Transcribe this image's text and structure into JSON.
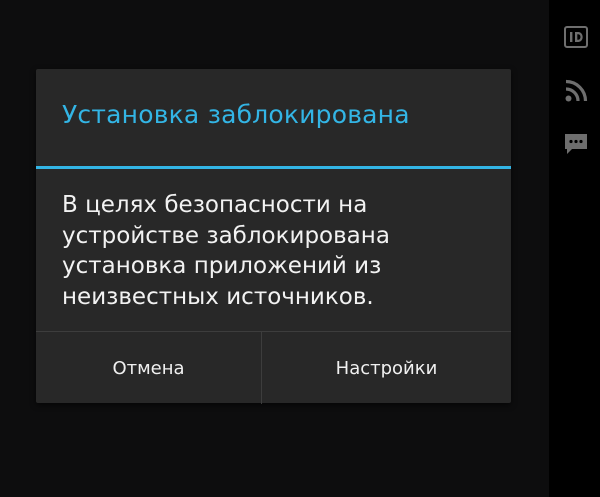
{
  "dialog": {
    "title": "Установка заблокирована",
    "message": "В целях безопасности на устройстве заблокирована установка приложений из неизвестных источников.",
    "buttons": {
      "cancel": "Отмена",
      "settings": "Настройки"
    }
  },
  "side_icons": [
    "id-badge-icon",
    "rss-feed-icon",
    "chat-bubble-icon"
  ],
  "colors": {
    "accent": "#33b5e5",
    "dialog_background": "#282828",
    "screen_background": "#0d0d0e",
    "icon_gray": "#6e6e6e"
  }
}
